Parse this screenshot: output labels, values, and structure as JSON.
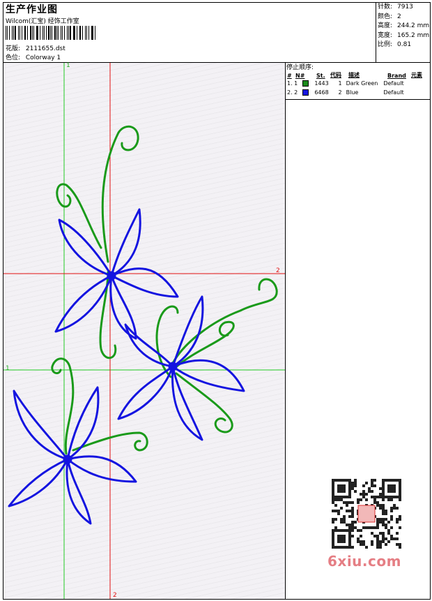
{
  "header": {
    "title": "生产作业图",
    "company": "Wilcom(汇宝) 经饰工作室",
    "design_label": "花版:",
    "design_value": "2111655.dst",
    "colorway_label": "色位:",
    "colorway_value": "Colorway 1"
  },
  "stats": {
    "stitches_label": "针数:",
    "stitches_value": "7913",
    "colors_label": "颜色:",
    "colors_value": "2",
    "height_label": "高度:",
    "height_value": "244.2 mm",
    "width_label": "宽度:",
    "width_value": "165.2 mm",
    "scale_label": "比例:",
    "scale_value": "0.81"
  },
  "stop_sequence": {
    "title": "停止顺序:",
    "headers": [
      "#",
      "N#",
      "St.",
      "代码",
      "描述",
      "Brand",
      "元素"
    ],
    "rows": [
      {
        "num": "1. 1",
        "color": "#1a8a1a",
        "stitches": "1443",
        "code": "1",
        "desc": "Dark Green",
        "brand": "Default",
        "element": ""
      },
      {
        "num": "2. 2",
        "color": "#1414e0",
        "stitches": "6468",
        "code": "2",
        "desc": "Blue",
        "brand": "Default",
        "element": ""
      }
    ]
  },
  "guides": {
    "green_top": "1",
    "green_left": "1",
    "red_right": "2",
    "red_bottom": "2"
  },
  "colors": {
    "green_thread": "#1a9a1a",
    "blue_thread": "#1414e0",
    "guide_green": "#22cc22",
    "guide_red": "#e01010"
  },
  "watermark": "6xiu.com"
}
